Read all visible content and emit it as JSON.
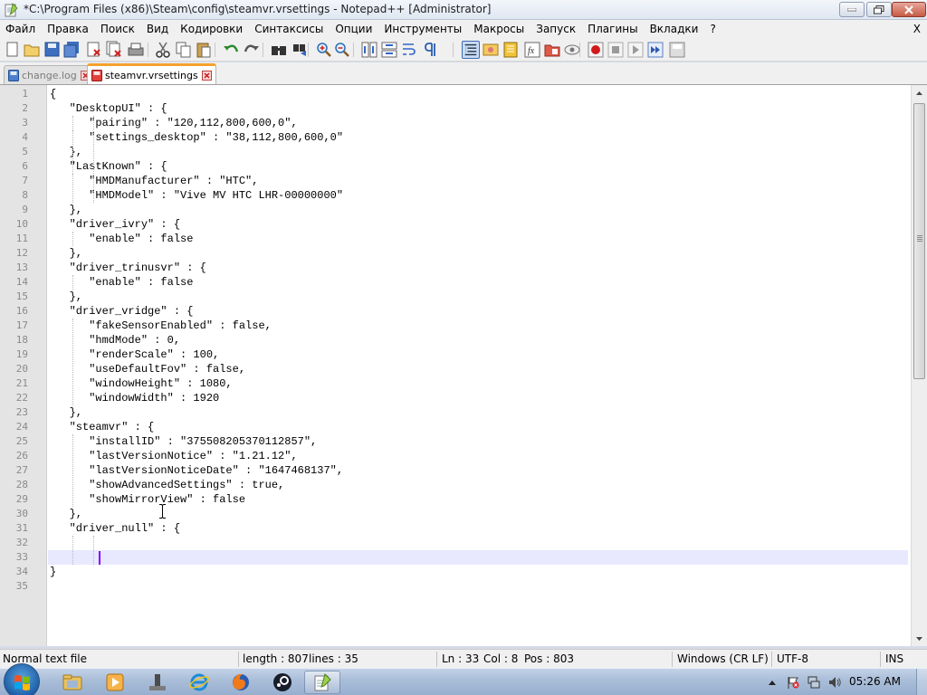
{
  "window": {
    "title": "*C:\\Program Files (x86)\\Steam\\config\\steamvr.vrsettings - Notepad++ [Administrator]"
  },
  "menu": {
    "items": [
      "Файл",
      "Правка",
      "Поиск",
      "Вид",
      "Кодировки",
      "Синтаксисы",
      "Опции",
      "Инструменты",
      "Макросы",
      "Запуск",
      "Плагины",
      "Вкладки",
      "?"
    ],
    "close_label": "X"
  },
  "toolbar": {
    "icons": [
      "new-file-icon",
      "open-file-icon",
      "save-icon",
      "save-all-icon",
      "close-icon",
      "close-all-icon",
      "print-icon",
      "cut-icon",
      "copy-icon",
      "paste-icon",
      "undo-icon",
      "redo-icon",
      "find-icon",
      "replace-icon",
      "zoom-in-icon",
      "zoom-out-icon",
      "sync-vertical-icon",
      "sync-horizontal-icon",
      "word-wrap-icon",
      "show-all-characters-icon",
      "indent-guide-icon",
      "user-language-icon",
      "doc-map-icon",
      "function-list-icon",
      "folder-workspace-icon",
      "monitoring-icon",
      "record-macro-icon",
      "stop-macro-icon",
      "play-macro-icon",
      "run-macro-multiple-icon",
      "save-macro-icon"
    ],
    "active_icon": "indent-guide-icon"
  },
  "tabs": [
    {
      "label": "change.log",
      "active": false
    },
    {
      "label": "steamvr.vrsettings",
      "active": true
    }
  ],
  "editor": {
    "lines": [
      "{",
      "   \"DesktopUI\" : {",
      "      \"pairing\" : \"120,112,800,600,0\",",
      "      \"settings_desktop\" : \"38,112,800,600,0\"",
      "   },",
      "   \"LastKnown\" : {",
      "      \"HMDManufacturer\" : \"HTC\",",
      "      \"HMDModel\" : \"Vive MV HTC LHR-00000000\"",
      "   },",
      "   \"driver_ivry\" : {",
      "      \"enable\" : false",
      "   },",
      "   \"driver_trinusvr\" : {",
      "      \"enable\" : false",
      "   },",
      "   \"driver_vridge\" : {",
      "      \"fakeSensorEnabled\" : false,",
      "      \"hmdMode\" : 0,",
      "      \"renderScale\" : 100,",
      "      \"useDefaultFov\" : false,",
      "      \"windowHeight\" : 1080,",
      "      \"windowWidth\" : 1920",
      "   },",
      "   \"steamvr\" : {",
      "      \"installID\" : \"375508205370112857\",",
      "      \"lastVersionNotice\" : \"1.21.12\",",
      "      \"lastVersionNoticeDate\" : \"1647468137\",",
      "      \"showAdvancedSettings\" : true,",
      "      \"showMirrorView\" : false",
      "   },",
      "   \"driver_null\" : {",
      "",
      "",
      "}",
      ""
    ],
    "current_line": 33,
    "caret_column": 8
  },
  "status": {
    "language": "Normal text file",
    "length": "length : 807",
    "lines": "lines : 35",
    "ln": "Ln : 33",
    "col": "Col : 8",
    "pos": "Pos : 803",
    "eol": "Windows (CR LF)",
    "encoding": "UTF-8",
    "mode": "INS"
  },
  "taskbar": {
    "apps": [
      "explorer-icon",
      "media-player-icon",
      "program-icon",
      "internet-explorer-icon",
      "firefox-icon",
      "steam-icon",
      "notepad-plus-plus-icon"
    ],
    "active_app": "notepad-plus-plus-icon",
    "clock": "05:26 AM"
  }
}
